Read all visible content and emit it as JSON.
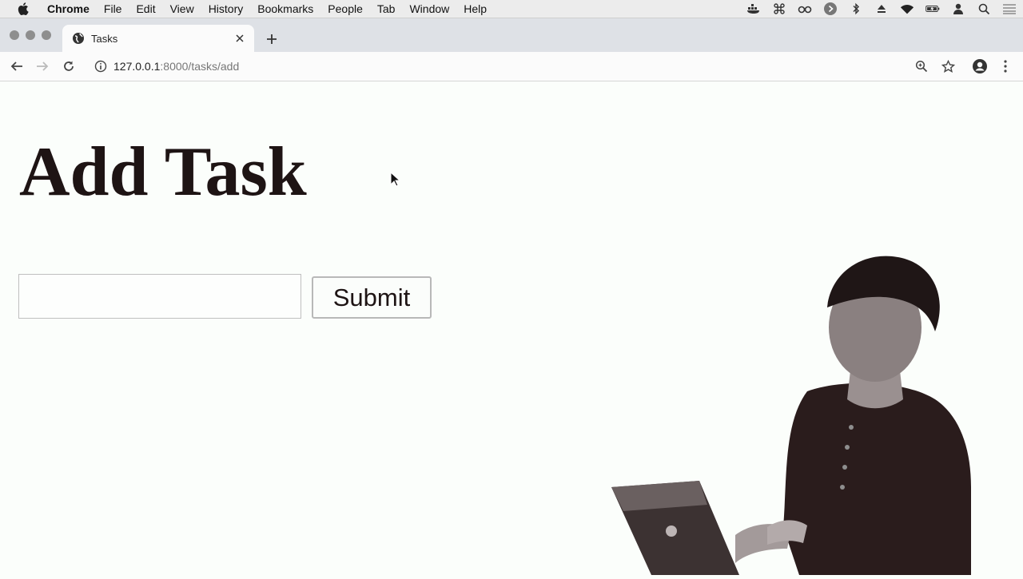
{
  "menubar": {
    "items": [
      "Chrome",
      "File",
      "Edit",
      "View",
      "History",
      "Bookmarks",
      "People",
      "Tab",
      "Window",
      "Help"
    ],
    "status_icons": [
      "docker-icon",
      "command-icon",
      "glasses-icon",
      "play-circle-icon",
      "bluetooth-icon",
      "eject-icon",
      "wifi-icon",
      "battery-icon",
      "user-icon",
      "spotlight-search-icon",
      "notification-list-icon"
    ]
  },
  "tab": {
    "title": "Tasks"
  },
  "omnibox": {
    "host": "127.0.0.1",
    "rest": ":8000/tasks/add"
  },
  "page": {
    "heading": "Add Task",
    "input_value": "",
    "submit_label": "Submit"
  },
  "colors": {
    "page_bg": "#fbfefb",
    "text": "#1e1414",
    "tabstrip": "#dee1e6"
  }
}
